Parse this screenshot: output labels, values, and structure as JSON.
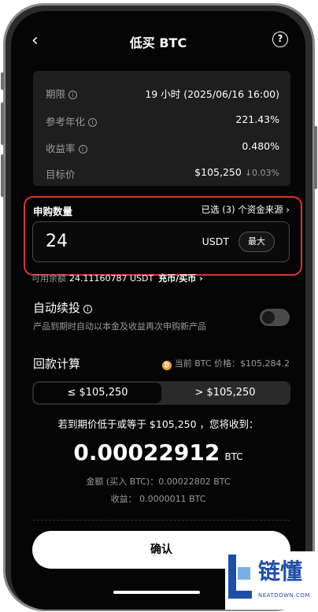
{
  "header": {
    "title": "低买 BTC",
    "back_icon": "chevron-left-icon",
    "help_icon": "help-circle-icon",
    "help_glyph": "?"
  },
  "info": {
    "period": {
      "label": "期限",
      "value": "19 小时 (2025/06/16 16:00)"
    },
    "apr": {
      "label": "参考年化",
      "value": "221.43%"
    },
    "yield": {
      "label": "收益率",
      "value": "0.480%"
    },
    "target": {
      "label": "目标价",
      "value": "$105,250",
      "change": "0.03%"
    }
  },
  "subscribe": {
    "label": "申购数量",
    "source_link": "已选 (3) 个资金来源",
    "amount": "24",
    "unit": "USDT",
    "max_label": "最大"
  },
  "balance": {
    "label": "可用余额",
    "value": "24.11160787 USDT",
    "link": "充币/买币"
  },
  "auto": {
    "title": "自动续投",
    "desc": "产品到期时自动以本金及收益再次申购新产品",
    "enabled": false
  },
  "calc": {
    "title": "回款计算",
    "btc_price": "当前 BTC 价格：$105,284.2",
    "options": [
      "≤ $105,250",
      "> $105,250"
    ],
    "selected": 0
  },
  "result": {
    "line": "若到期价低于或等于 $105,250 ，您将收到：",
    "amount": "0.00022912",
    "currency": "BTC",
    "detail_amount": "金额 (买入 BTC)：0.00022802 BTC",
    "detail_profit": "收益： 0.0000011 BTC"
  },
  "confirm_label": "确认",
  "watermark": {
    "text": "链懂",
    "sub": "NEATDOWN.COM"
  },
  "colors": {
    "highlight": "#e0332a",
    "btc_coin": "#f2a23b",
    "watermark": "#1e4fa8"
  }
}
